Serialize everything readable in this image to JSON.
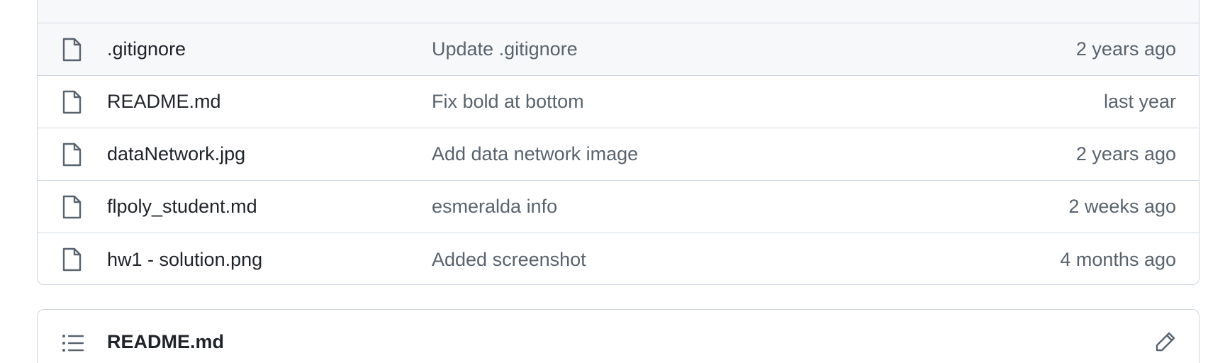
{
  "files": [
    {
      "name": ".gitignore",
      "commit": "Update .gitignore",
      "age": "2 years ago",
      "icon": "file-icon"
    },
    {
      "name": "README.md",
      "commit": "Fix bold at bottom",
      "age": "last year",
      "icon": "file-icon"
    },
    {
      "name": "dataNetwork.jpg",
      "commit": "Add data network image",
      "age": "2 years ago",
      "icon": "file-icon"
    },
    {
      "name": "flpoly_student.md",
      "commit": "esmeralda info",
      "age": "2 weeks ago",
      "icon": "file-icon"
    },
    {
      "name": "hw1 - solution.png",
      "commit": "Added screenshot",
      "age": "4 months ago",
      "icon": "file-icon"
    }
  ],
  "readme": {
    "title": "README.md",
    "outline_icon": "list-icon",
    "edit_icon": "pencil-icon"
  },
  "colors": {
    "border": "#d0d7de",
    "header_bg": "#f6f8fa",
    "text_primary": "#1f2328",
    "text_muted": "#59636e"
  }
}
